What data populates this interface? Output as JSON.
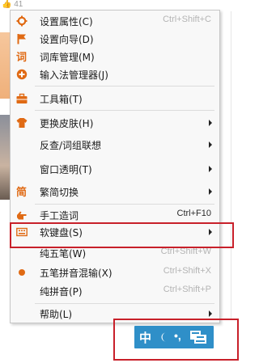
{
  "background": {
    "likes_count": "41"
  },
  "menu": {
    "items": [
      {
        "label": "设置属性(C)",
        "shortcut": "Ctrl+Shift+C",
        "icon": "gear-icon"
      },
      {
        "label": "设置向导(D)",
        "shortcut": "",
        "icon": "flag-icon"
      },
      {
        "label": "词库管理(M)",
        "shortcut": "",
        "icon": "dictionary-icon"
      },
      {
        "label": "输入法管理器(J)",
        "shortcut": "",
        "icon": "ime-manager-icon"
      },
      {
        "label": "工具箱(T)",
        "shortcut": "",
        "icon": "toolbox-icon"
      },
      {
        "label": "更换皮肤(H)",
        "shortcut": "",
        "icon": "shirt-icon"
      },
      {
        "label": "反查/词组联想",
        "shortcut": "",
        "icon": ""
      },
      {
        "label": "窗口透明(T)",
        "shortcut": "",
        "icon": ""
      },
      {
        "label": "繁简切换",
        "shortcut": "",
        "icon": "traditional-simplified-icon"
      },
      {
        "label": "手工造词",
        "shortcut": "Ctrl+F10",
        "icon": "hand-icon"
      },
      {
        "label": "软键盘(S)",
        "shortcut": "",
        "icon": "soft-keyboard-icon"
      },
      {
        "label": "纯五笔(W)",
        "shortcut": "Ctrl+Shift+W",
        "icon": ""
      },
      {
        "label": "五笔拼音混输(X)",
        "shortcut": "Ctrl+Shift+X",
        "icon": "selected-dot-icon"
      },
      {
        "label": "纯拼音(P)",
        "shortcut": "Ctrl+Shift+P",
        "icon": ""
      },
      {
        "label": "帮助(L)",
        "shortcut": "",
        "icon": ""
      }
    ]
  },
  "ime_bar": {
    "mode_label": "中",
    "punct_label": "•,",
    "icons": [
      "half-moon-icon",
      "soft-keyboard-icon"
    ]
  },
  "colors": {
    "accent_orange": "#e06a14",
    "highlight_red": "#c8202a",
    "ime_blue": "#2f8fc8"
  }
}
